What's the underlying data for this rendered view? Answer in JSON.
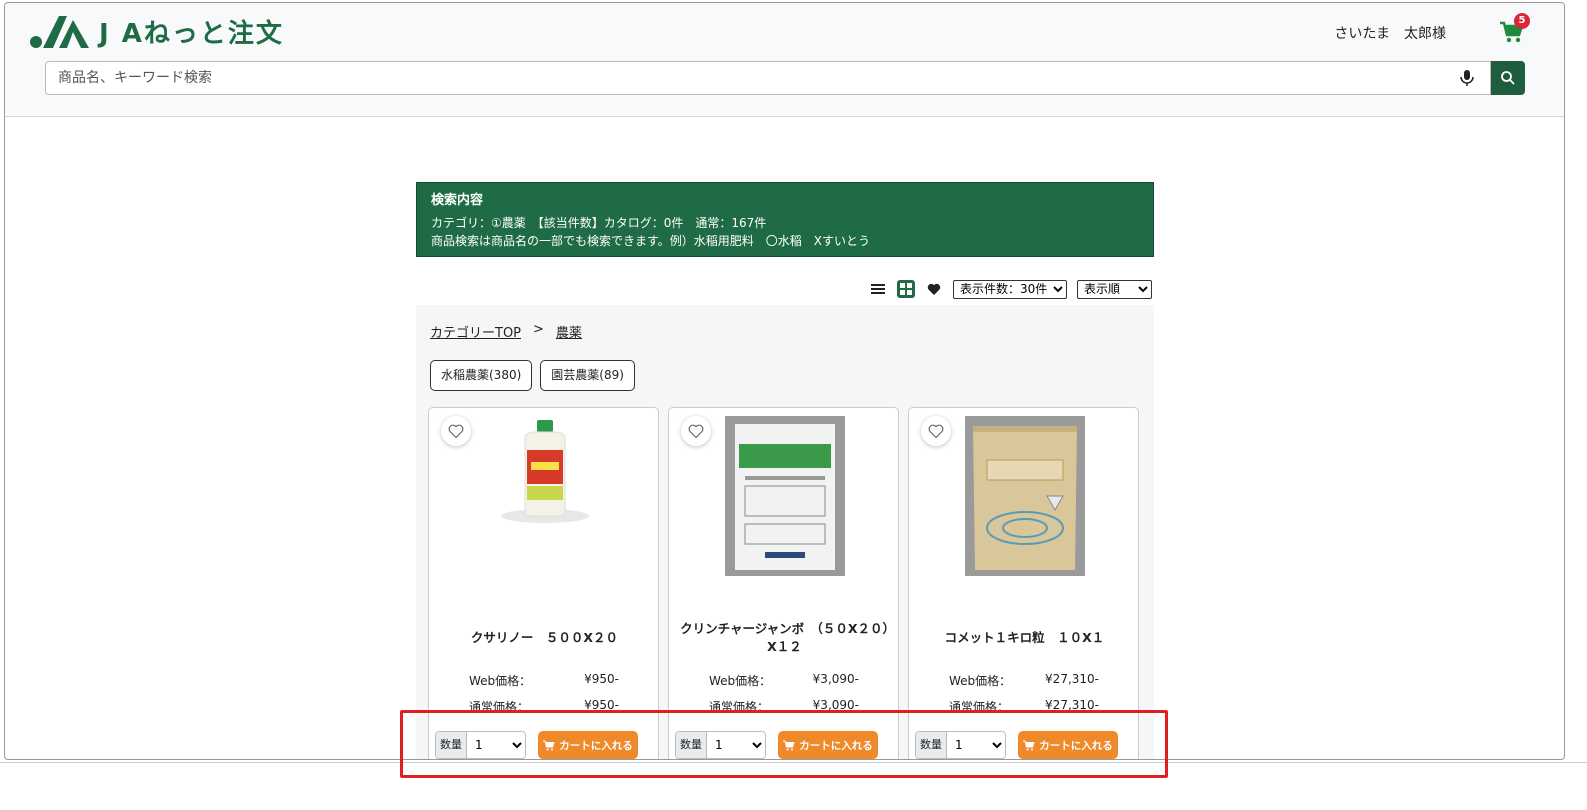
{
  "header": {
    "logo_text": "J Aねっと注文",
    "user_name": "さいたま　太郎様",
    "cart_count": "5",
    "search": {
      "placeholder": "商品名、キーワード検索"
    }
  },
  "search_result": {
    "title": "検索内容",
    "line1": "カテゴリ：①農薬　【該当件数】カタログ：0件　通常：167件",
    "line2": "商品検索は商品名の一部でも検索できます。例）水稲用肥料　〇水稲　Xすいとう"
  },
  "toolbar": {
    "per_page_label": "表示件数：30件",
    "sort_label": "表示順"
  },
  "breadcrumb": {
    "top": "カテゴリーTOP",
    "sep": ">",
    "current": "農薬"
  },
  "subcategories": [
    {
      "label": "水稲農薬(380)"
    },
    {
      "label": "園芸農薬(89)"
    }
  ],
  "products": [
    {
      "name": "クサリノー　５００X２０",
      "web_label": "Web価格：",
      "web_price": "¥950-",
      "std_label": "通常価格：",
      "std_price": "¥950-",
      "qty_label": "数量",
      "qty": "1",
      "cart_label": "カートに入れる",
      "image": "bottle-icon"
    },
    {
      "name": "クリンチャージャンボ　（５０X２０）X１２",
      "web_label": "Web価格：",
      "web_price": "¥3,090-",
      "std_label": "通常価格：",
      "std_price": "¥3,090-",
      "qty_label": "数量",
      "qty": "1",
      "cart_label": "カートに入れる",
      "image": "pouch-icon"
    },
    {
      "name": "コメット１キロ粒　１０X１",
      "web_label": "Web価格：",
      "web_price": "¥27,310-",
      "std_label": "通常価格：",
      "std_price": "¥27,310-",
      "qty_label": "数量",
      "qty": "1",
      "cart_label": "カートに入れる",
      "image": "sack-icon"
    }
  ],
  "colors": {
    "brand": "#1e6b45",
    "cart_button": "#ee8a2a",
    "badge": "#d9263a",
    "highlight": "#e02020"
  }
}
